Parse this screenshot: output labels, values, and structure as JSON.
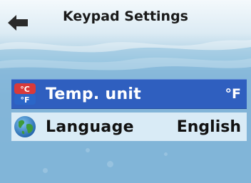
{
  "header": {
    "title": "Keypad Settings",
    "back_icon": "arrow-left-icon"
  },
  "settings": [
    {
      "label": "Temp. unit",
      "value": "°F",
      "icon": "temperature-unit-icon",
      "icon_text_c": "°C",
      "icon_text_f": "°F",
      "selected": true
    },
    {
      "label": "Language",
      "value": "English",
      "icon": "globe-icon",
      "selected": false
    }
  ],
  "colors": {
    "selected_row": "#2f5fbf",
    "row": "#d9ebf6"
  }
}
